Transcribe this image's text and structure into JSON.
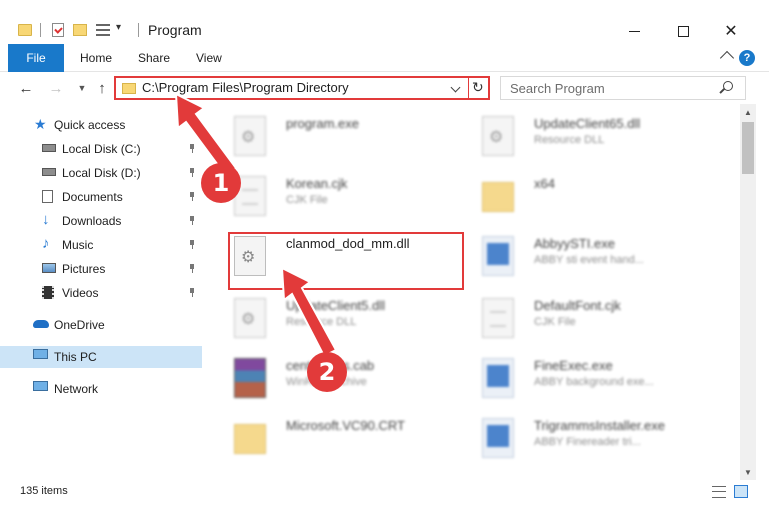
{
  "window": {
    "title": "Program",
    "minimize_label": "—",
    "close_label": "✕"
  },
  "ribbon": {
    "tabs": [
      "File",
      "Home",
      "Share",
      "View"
    ],
    "help_label": "?"
  },
  "address": {
    "path": "C:\\Program Files\\Program Directory",
    "search_placeholder": "Search Program"
  },
  "nav": {
    "items": [
      {
        "label": "Quick access",
        "icon": "star-icon",
        "pinned": false
      },
      {
        "label": "Local Disk (C:)",
        "icon": "drive-icon",
        "pinned": true
      },
      {
        "label": "Local Disk (D:)",
        "icon": "drive-icon",
        "pinned": true
      },
      {
        "label": "Documents",
        "icon": "documents-icon",
        "pinned": true
      },
      {
        "label": "Downloads",
        "icon": "download-icon",
        "pinned": true
      },
      {
        "label": "Music",
        "icon": "music-icon",
        "pinned": true
      },
      {
        "label": "Pictures",
        "icon": "pictures-icon",
        "pinned": true
      },
      {
        "label": "Videos",
        "icon": "videos-icon",
        "pinned": true
      },
      {
        "label": "OneDrive",
        "icon": "cloud-icon",
        "pinned": false
      },
      {
        "label": "This PC",
        "icon": "computer-icon",
        "pinned": false,
        "selected": true
      },
      {
        "label": "Network",
        "icon": "network-icon",
        "pinned": false
      }
    ]
  },
  "files": [
    {
      "name": "program.exe",
      "desc": "",
      "icon": "installer-icon"
    },
    {
      "name": "UpdateClient65.dll",
      "desc": "Resource DLL",
      "icon": "dll-icon"
    },
    {
      "name": "Korean.cjk",
      "desc": "CJK File",
      "icon": "file-icon"
    },
    {
      "name": "x64",
      "desc": "",
      "icon": "folder-icon"
    },
    {
      "name": "clanmod_dod_mm.dll",
      "desc": "",
      "icon": "dll-gear-icon"
    },
    {
      "name": "AbbyySTI.exe",
      "desc": "ABBY sti event hand...",
      "icon": "exe-icon"
    },
    {
      "name": "UpdateClient5.dll",
      "desc": "Resource DLL",
      "icon": "dll-icon"
    },
    {
      "name": "DefaultFont.cjk",
      "desc": "CJK File",
      "icon": "file-icon"
    },
    {
      "name": "centertools.cab",
      "desc": "WinRAR archive",
      "icon": "archive-icon"
    },
    {
      "name": "FineExec.exe",
      "desc": "ABBY background exe...",
      "icon": "exe-icon"
    },
    {
      "name": "Microsoft.VC90.CRT",
      "desc": "",
      "icon": "folder-icon"
    },
    {
      "name": "TrigrammsInstaller.exe",
      "desc": "ABBY Finereader tri...",
      "icon": "exe-icon"
    }
  ],
  "annotations": {
    "badge_1": "1",
    "badge_2": "2",
    "accent": "#e23a3a"
  },
  "status": {
    "item_count": "135 items"
  }
}
